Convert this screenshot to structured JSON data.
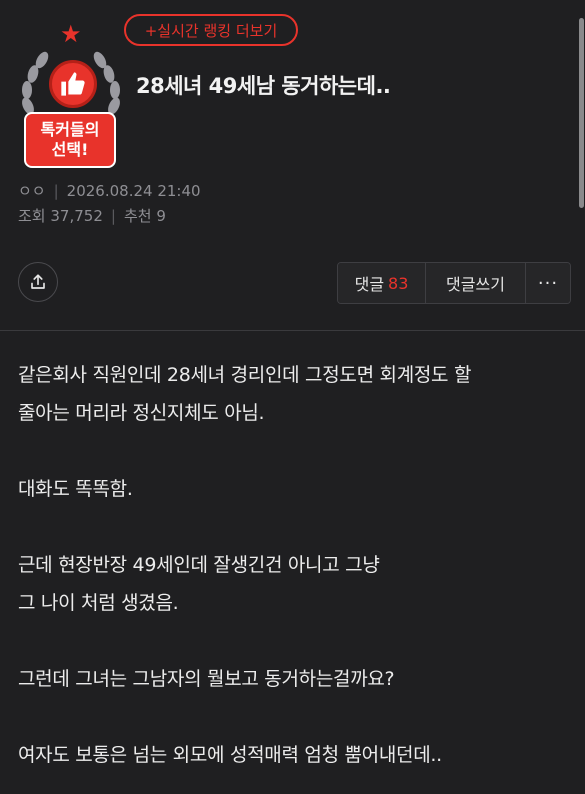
{
  "header": {
    "ranking_link": "+실시간 랭킹 더보기",
    "badge_line1": "톡커들의",
    "badge_line2": "선택!",
    "title": "28세녀 49세남 동거하는데.."
  },
  "meta": {
    "author": "ㅇㅇ",
    "datetime": "2026.08.24 21:40",
    "views_label": "조회",
    "views": "37,752",
    "likes_label": "추천",
    "likes": "9"
  },
  "actions": {
    "comments_label": "댓글",
    "comments_count": "83",
    "write_label": "댓글쓰기",
    "more_label": "···"
  },
  "body": {
    "paragraphs": [
      [
        "같은회사 직원인데 28세녀 경리인데 그정도면 회계정도 할",
        "줄아는 머리라 정신지체도 아님."
      ],
      [
        "대화도 똑똑함."
      ],
      [
        "근데 현장반장 49세인데 잘생긴건 아니고 그냥",
        "그 나이 처럼 생겼음."
      ],
      [
        "그런데 그녀는 그남자의 뭘보고 동거하는걸까요?"
      ],
      [
        "여자도 보통은 넘는 외모에 성적매력 엄청 뿜어내던데.."
      ]
    ]
  },
  "colors": {
    "accent": "#e8332b",
    "background": "#1f1f21",
    "text": "#ececec",
    "muted": "#8e8e93"
  }
}
